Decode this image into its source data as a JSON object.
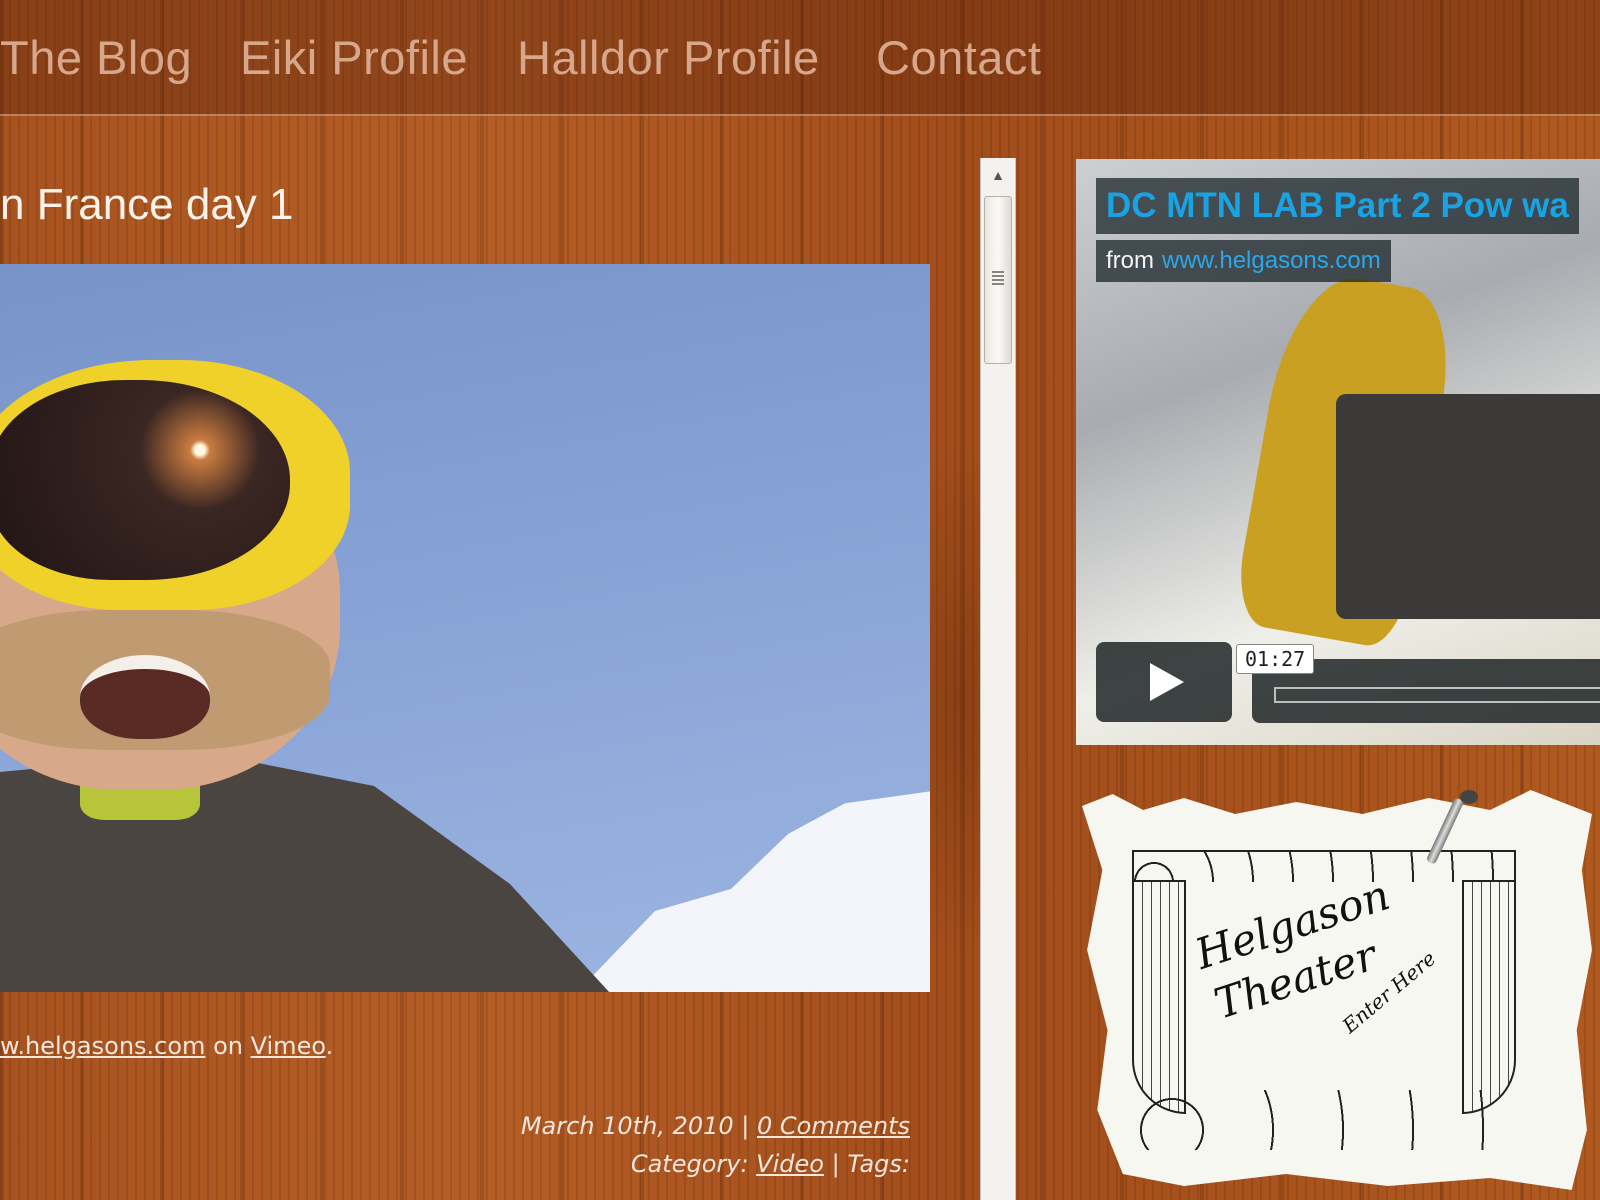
{
  "nav": {
    "items": [
      "The Blog",
      "Eiki Profile",
      "Halldor Profile",
      "Contact"
    ]
  },
  "post": {
    "title": "n France day 1",
    "caption_link1": "w.helgasons.com",
    "caption_on": "on",
    "caption_link2": "Vimeo",
    "caption_end": ".",
    "date": "March 10th, 2010",
    "sep": "|",
    "comments": "0 Comments",
    "category_label": "Category:",
    "category": "Video",
    "tags_label": "Tags:"
  },
  "side_video": {
    "title": "DC MTN LAB Part 2 Pow wa",
    "from_label": "from",
    "from_link": "www.helgasons.com",
    "duration": "01:27"
  },
  "theater": {
    "line1": "Helgason",
    "line2": "Theater",
    "enter": "Enter Here"
  },
  "colors": {
    "nav_text": "#d7a78b",
    "accent_blue": "#1aa3e4",
    "wood": "#b55d26"
  }
}
